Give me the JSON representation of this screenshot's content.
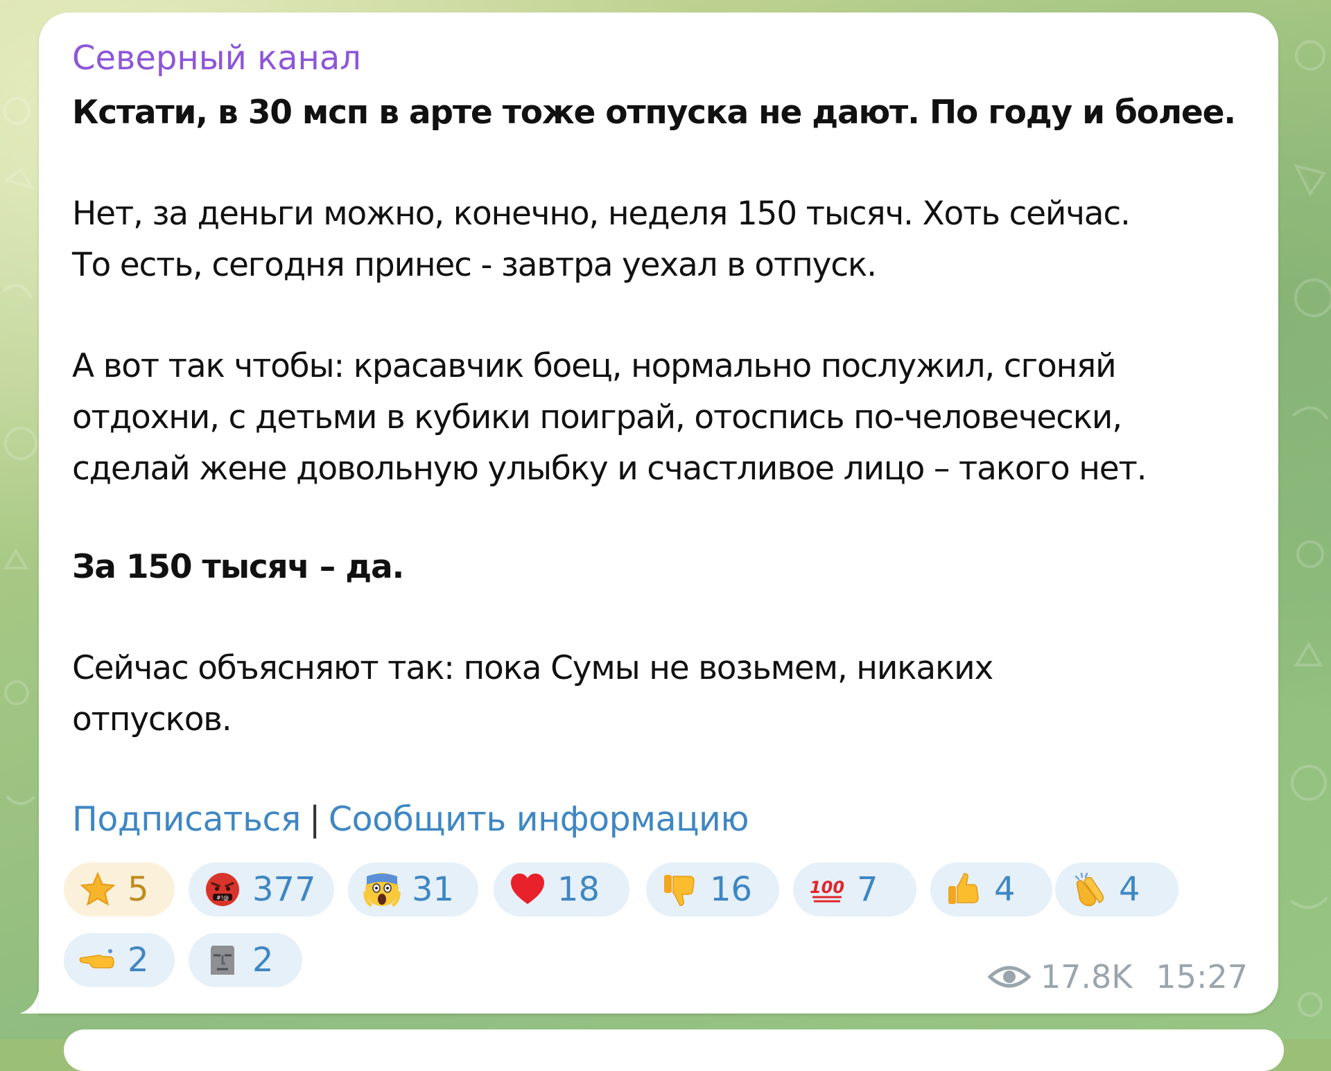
{
  "channel": {
    "name": "Северный канал"
  },
  "message": {
    "p1": "Кстати, в 30 мсп в арте тоже отпуска не дают. По году и более.",
    "p2_line1": "Нет, за деньги можно, конечно, неделя 150 тысяч. Хоть сейчас.",
    "p2_line2": "То есть, сегодня принес - завтра уехал в отпуск.",
    "p3_line1": "А вот так чтобы: красавчик боец, нормально послужил, сгоняй",
    "p3_line2": "отдохни, с детьми в кубики поиграй, отоспись по-человечески,",
    "p3_line3": "сделай жене довольную улыбку и счастливое лицо – такого нет.",
    "p4": "За 150 тысяч – да.",
    "p5_line1": "Сейчас объясняют так: пока Сумы не возьмем, никаких",
    "p5_line2": "отпусков."
  },
  "links": {
    "subscribe": "Подписаться",
    "separator": "|",
    "report": "Сообщить информацию"
  },
  "reactions": [
    {
      "icon": "star-icon",
      "count": "5",
      "paid": true
    },
    {
      "icon": "angry-cursing-face-icon",
      "count": "377"
    },
    {
      "icon": "screaming-face-icon",
      "count": "31"
    },
    {
      "icon": "heart-icon",
      "count": "18"
    },
    {
      "icon": "thumbs-down-icon",
      "count": "16"
    },
    {
      "icon": "hundred-points-icon",
      "count": "7"
    },
    {
      "icon": "thumbs-up-icon",
      "count": "4"
    },
    {
      "icon": "clapping-hands-icon",
      "count": "4"
    },
    {
      "icon": "pointing-hand-icon",
      "count": "2"
    },
    {
      "icon": "moai-icon",
      "count": "2"
    }
  ],
  "meta": {
    "views": "17.8K",
    "time": "15:27"
  },
  "colors": {
    "channel_name": "#8d56d8",
    "link": "#3f87c3",
    "reaction_bg": "#e6f0f8",
    "paid_reaction_bg": "#fbf1db",
    "meta": "#9aa5ad"
  }
}
